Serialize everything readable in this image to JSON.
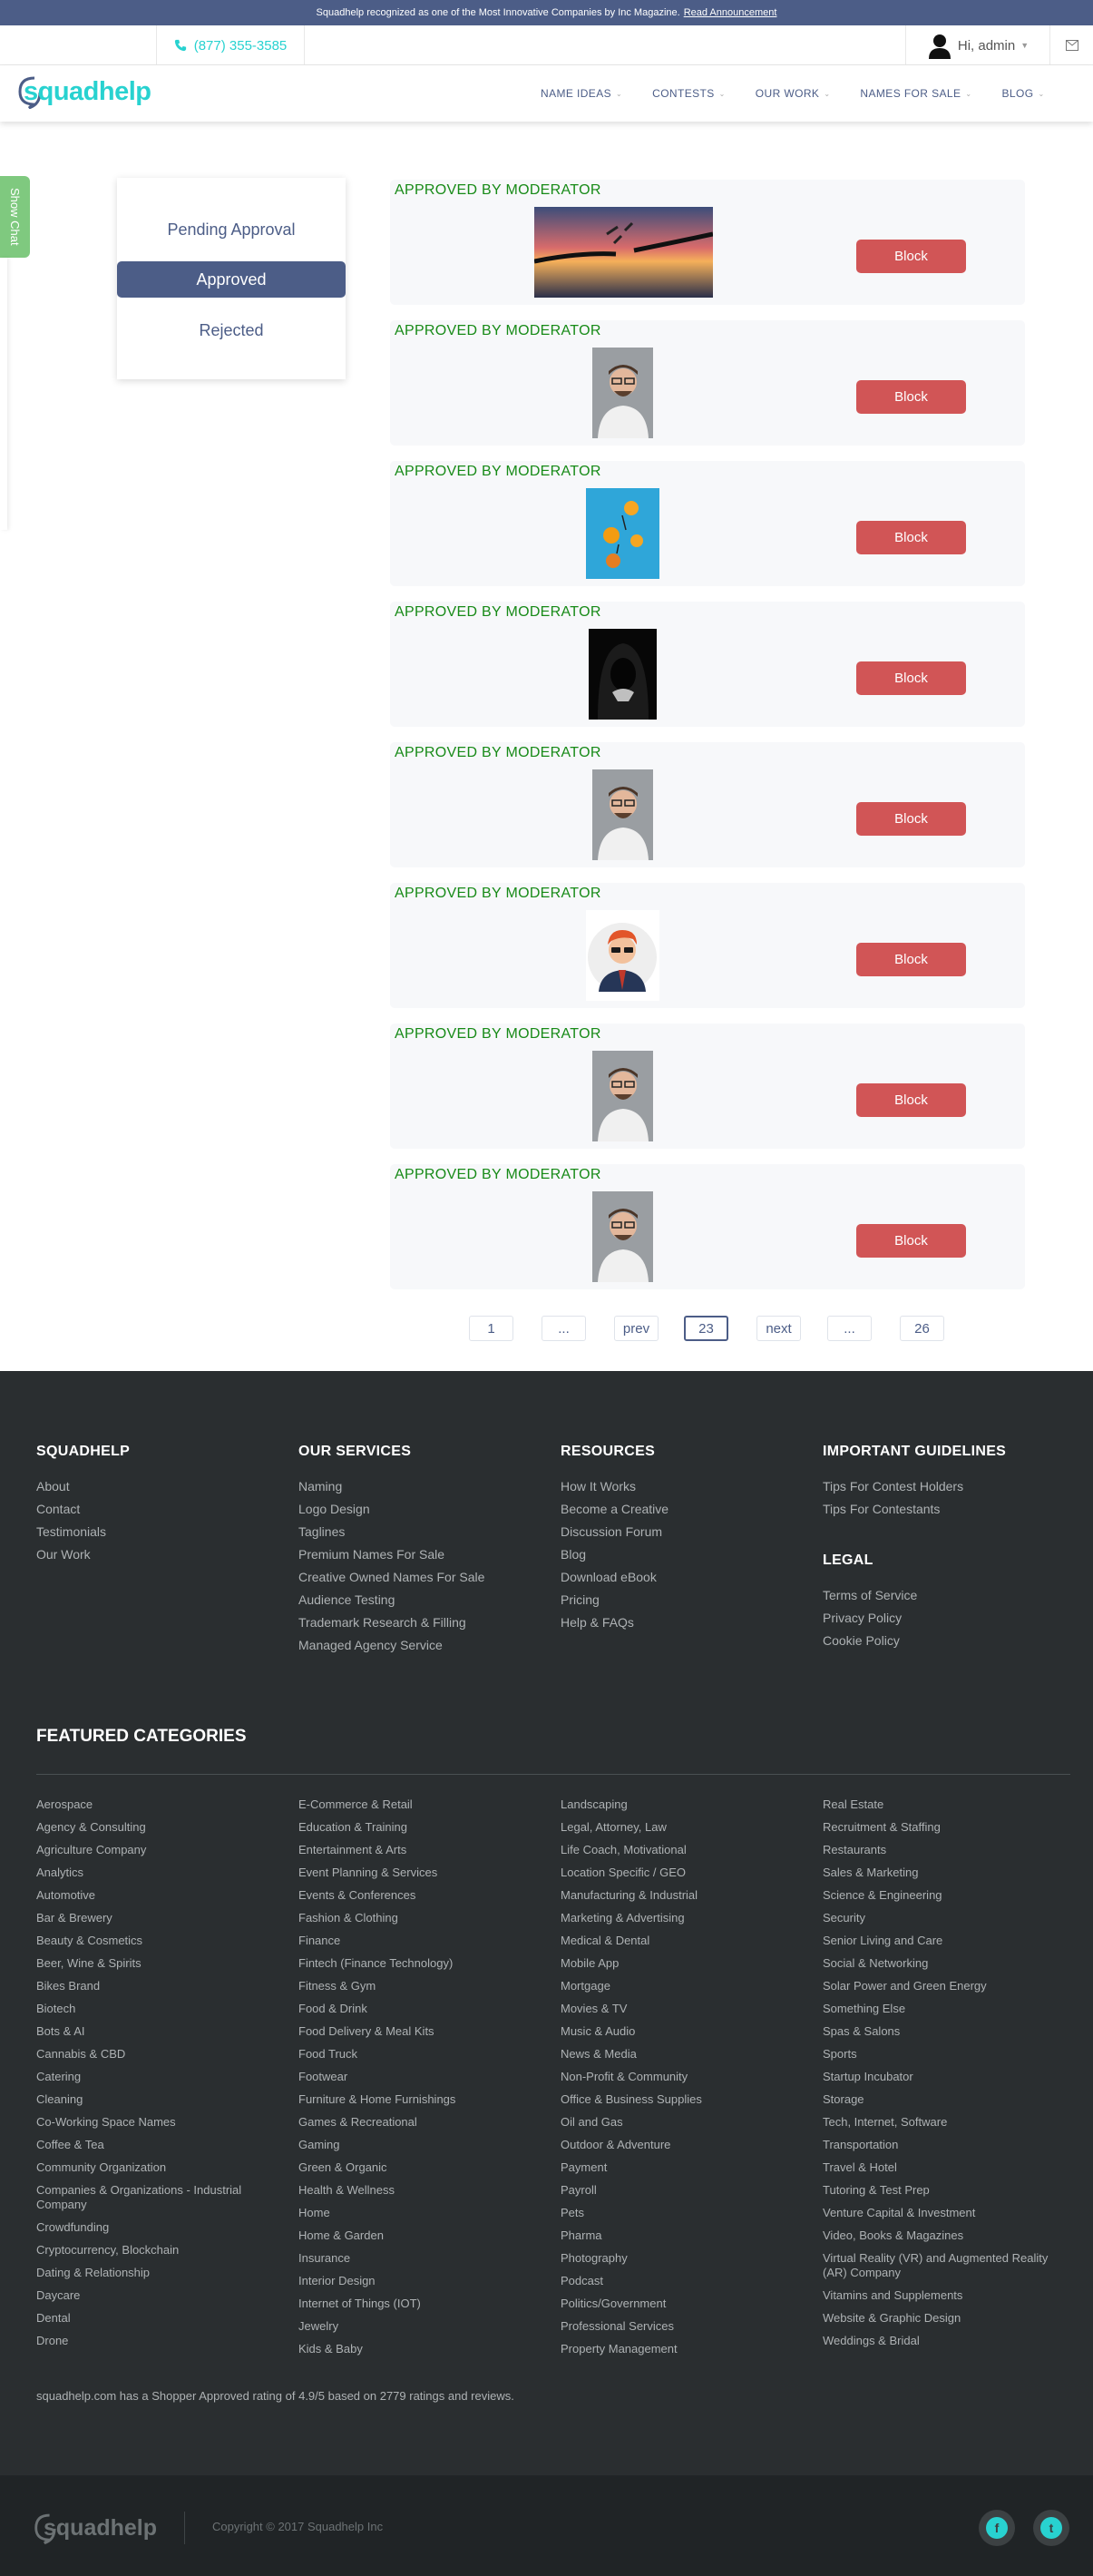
{
  "announcement": {
    "text": "Squadhelp recognized as one of the Most Innovative Companies by Inc Magazine.",
    "link": "Read Announcement"
  },
  "topbar": {
    "phone": "(877) 355-3585",
    "user_greeting": "Hi, admin"
  },
  "header": {
    "logo": "squadhelp",
    "nav": [
      "NAME IDEAS",
      "CONTESTS",
      "OUR WORK",
      "NAMES FOR SALE",
      "BLOG"
    ]
  },
  "chat": {
    "label": "Show Chat"
  },
  "filter": {
    "items": [
      "Pending Approval",
      "Approved",
      "Rejected"
    ],
    "active": "Approved"
  },
  "offers": [
    {
      "status": "APPROVED BY MODERATOR",
      "image": "broken-chain-sunset-image",
      "action": "Block"
    },
    {
      "status": "APPROVED BY MODERATOR",
      "image": "smiling-man-glasses-photo",
      "action": "Block"
    },
    {
      "status": "APPROVED BY MODERATOR",
      "image": "orange-slices-blue-photo",
      "action": "Block"
    },
    {
      "status": "APPROVED BY MODERATOR",
      "image": "hooded-figure-dark-photo",
      "action": "Block"
    },
    {
      "status": "APPROVED BY MODERATOR",
      "image": "smiling-man-glasses-photo",
      "action": "Block"
    },
    {
      "status": "APPROVED BY MODERATOR",
      "image": "cartoon-businessman-avatar",
      "action": "Block"
    },
    {
      "status": "APPROVED BY MODERATOR",
      "image": "smiling-man-glasses-photo",
      "action": "Block"
    },
    {
      "status": "APPROVED BY MODERATOR",
      "image": "smiling-man-glasses-photo",
      "action": "Block"
    }
  ],
  "pagination": {
    "first": "1",
    "ellipsis": "...",
    "prev": "prev",
    "current": "23",
    "next": "next",
    "last": "26"
  },
  "footer": {
    "columns": [
      {
        "title": "SQUADHELP",
        "links": [
          "About",
          "Contact",
          "Testimonials",
          "Our Work"
        ]
      },
      {
        "title": "OUR SERVICES",
        "links": [
          "Naming",
          "Logo Design",
          "Taglines",
          "Premium Names For Sale",
          "Creative Owned Names For Sale",
          "Audience Testing",
          "Trademark Research & Filling",
          "Managed Agency Service"
        ]
      },
      {
        "title": "RESOURCES",
        "links": [
          "How It Works",
          "Become a Creative",
          "Discussion Forum",
          "Blog",
          "Download eBook",
          "Pricing",
          "Help & FAQs"
        ]
      },
      {
        "title": "IMPORTANT GUIDELINES",
        "links": [
          "Tips For Contest Holders",
          "Tips For Contestants"
        ]
      }
    ],
    "legal": {
      "title": "LEGAL",
      "links": [
        "Terms of Service",
        "Privacy Policy",
        "Cookie Policy"
      ]
    },
    "featured_title": "FEATURED CATEGORIES",
    "categories": [
      [
        "Aerospace",
        "Agency & Consulting",
        "Agriculture Company",
        "Analytics",
        "Automotive",
        "Bar & Brewery",
        "Beauty & Cosmetics",
        "Beer, Wine & Spirits",
        "Bikes Brand",
        "Biotech",
        "Bots & AI",
        "Cannabis & CBD",
        "Catering",
        "Cleaning",
        "Co-Working Space Names",
        "Coffee & Tea",
        "Community Organization",
        "Companies & Organizations - Industrial Company",
        "Crowdfunding",
        "Cryptocurrency, Blockchain",
        "Dating & Relationship",
        "Daycare",
        "Dental",
        "Drone"
      ],
      [
        "E-Commerce & Retail",
        "Education & Training",
        "Entertainment & Arts",
        "Event Planning & Services",
        "Events & Conferences",
        "Fashion & Clothing",
        "Finance",
        "Fintech (Finance Technology)",
        "Fitness & Gym",
        "Food & Drink",
        "Food Delivery & Meal Kits",
        "Food Truck",
        "Footwear",
        "Furniture & Home Furnishings",
        "Games & Recreational",
        "Gaming",
        "Green & Organic",
        "Health & Wellness",
        "Home",
        "Home & Garden",
        "Insurance",
        "Interior Design",
        "Internet of Things (IOT)",
        "Jewelry",
        "Kids & Baby"
      ],
      [
        "Landscaping",
        "Legal, Attorney, Law",
        "Life Coach, Motivational",
        "Location Specific / GEO",
        "Manufacturing & Industrial",
        "Marketing & Advertising",
        "Medical & Dental",
        "Mobile App",
        "Mortgage",
        "Movies & TV",
        "Music & Audio",
        "News & Media",
        "Non-Profit & Community",
        "Office & Business Supplies",
        "Oil and Gas",
        "Outdoor & Adventure",
        "Payment",
        "Payroll",
        "Pets",
        "Pharma",
        "Photography",
        "Podcast",
        "Politics/Government",
        "Professional Services",
        "Property Management"
      ],
      [
        "Real Estate",
        "Recruitment & Staffing",
        "Restaurants",
        "Sales & Marketing",
        "Science & Engineering",
        "Security",
        "Senior Living and Care",
        "Social & Networking",
        "Solar Power and Green Energy",
        "Something Else",
        "Spas & Salons",
        "Sports",
        "Startup Incubator",
        "Storage",
        "Tech, Internet, Software",
        "Transportation",
        "Travel & Hotel",
        "Tutoring & Test Prep",
        "Venture Capital & Investment",
        "Video, Books & Magazines",
        "Virtual Reality (VR) and Augmented Reality (AR) Company",
        "Vitamins and Supplements",
        "Website & Graphic Design",
        "Weddings & Bridal"
      ]
    ],
    "rating_text": "squadhelp.com has a Shopper Approved rating of 4.9/5 based on 2779 ratings and reviews.",
    "bottom_logo": "squadhelp",
    "copyright": "Copyright © 2017 Squadhelp Inc",
    "social": [
      "facebook-icon",
      "twitter-icon"
    ]
  },
  "colors": {
    "brand_navy": "#4c5d87",
    "brand_teal": "#28d2d0",
    "approved_green": "#178a17",
    "block_red": "#d15556",
    "footer_bg": "#2a2e30"
  }
}
